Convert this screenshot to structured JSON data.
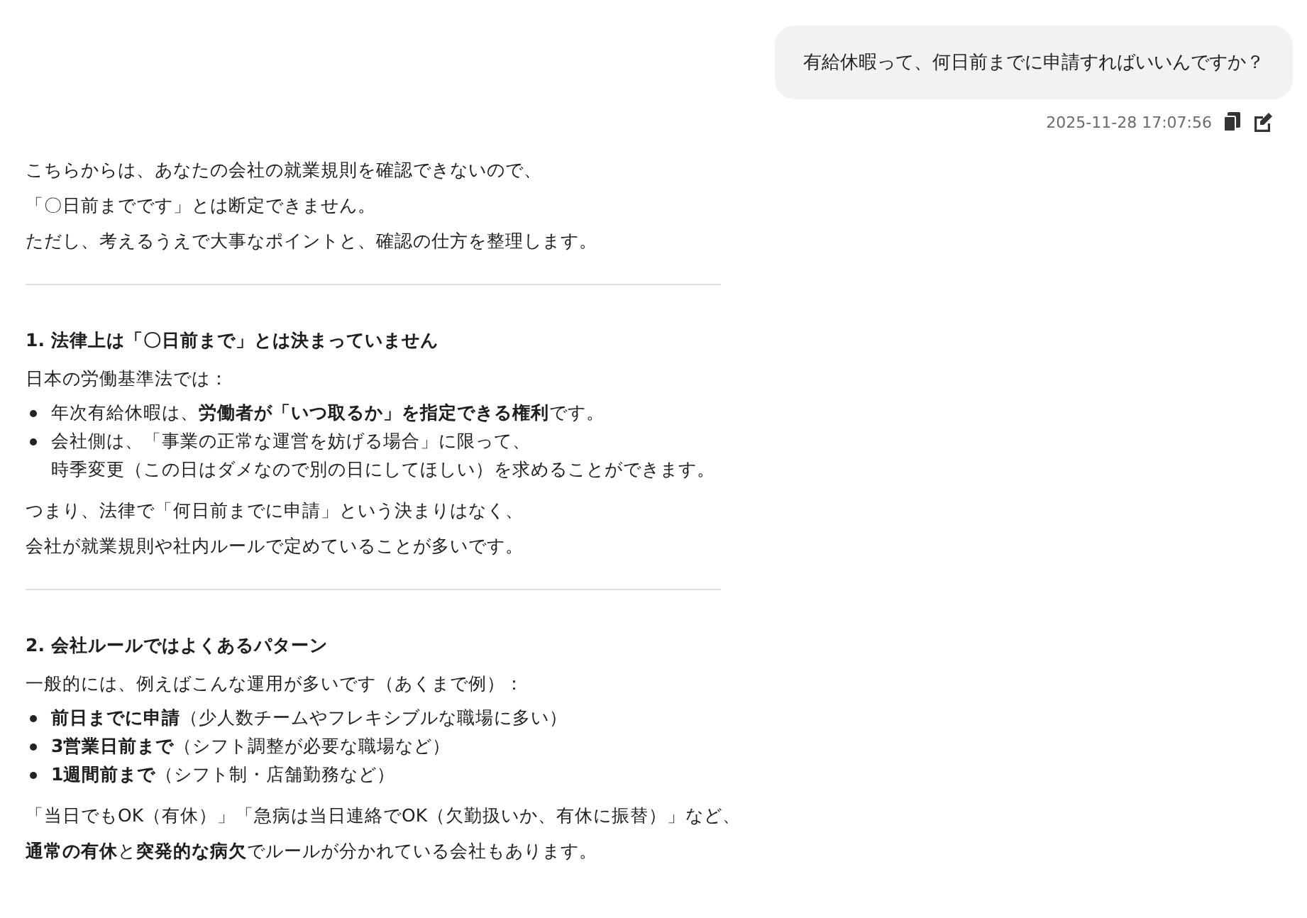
{
  "user_message": {
    "text": "有給休暇って、何日前までに申請すればいいんですか？",
    "timestamp": "2025-11-28 17:07:56"
  },
  "answer": [
    {
      "kind": "paragraph",
      "lines": [
        "こちらからは、あなたの会社の就業規則を確認できないので、",
        "「〇日前までです」とは断定できません。",
        "ただし、考えるうえで大事なポイントと、確認の仕方を整理します。"
      ]
    },
    {
      "kind": "divider"
    },
    {
      "kind": "heading",
      "text": "1. 法律上は「〇日前まで」とは決まっていません"
    },
    {
      "kind": "paragraph",
      "lines": [
        "日本の労働基準法では："
      ]
    },
    {
      "kind": "list",
      "items": [
        [
          "年次有給休暇は、**労働者が「いつ取るか」を指定できる権利**です。"
        ],
        [
          "会社側は、「事業の正常な運営を妨げる場合」に限って、",
          "時季変更（この日はダメなので別の日にしてほしい）を求めることができます。"
        ]
      ]
    },
    {
      "kind": "paragraph",
      "lines": [
        "つまり、法律で「何日前までに申請」という決まりはなく、",
        "会社が就業規則や社内ルールで定めていることが多いです。"
      ]
    },
    {
      "kind": "divider"
    },
    {
      "kind": "heading",
      "text": "2. 会社ルールではよくあるパターン"
    },
    {
      "kind": "paragraph",
      "lines": [
        "一般的には、例えばこんな運用が多いです（あくまで例）："
      ]
    },
    {
      "kind": "list",
      "items": [
        [
          "**前日までに申請**（少人数チームやフレキシブルな職場に多い）"
        ],
        [
          "**3営業日前まで**（シフト調整が必要な職場など）"
        ],
        [
          "**1週間前まで**（シフト制・店舗勤務など）"
        ]
      ]
    },
    {
      "kind": "paragraph",
      "lines": [
        "「当日でもOK（有休）」「急病は当日連絡でOK（欠勤扱いか、有休に振替）」など、",
        "**通常の有休**と**突発的な病欠**でルールが分かれている会社もあります。"
      ]
    }
  ]
}
